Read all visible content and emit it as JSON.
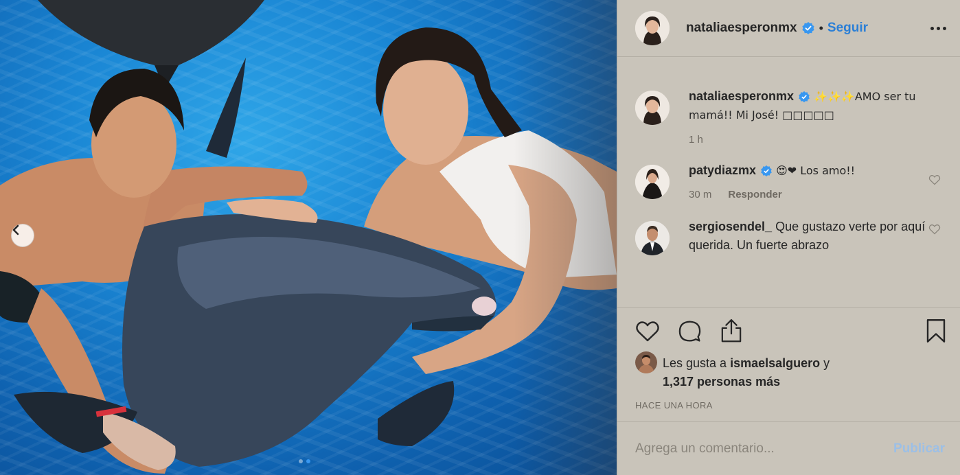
{
  "post": {
    "username": "nataliaesperonmx",
    "separator": "•",
    "follow_label": "Seguir",
    "more_icon": "more-options-icon"
  },
  "comments": [
    {
      "username": "nataliaesperonmx",
      "text": "✨✨✨AMO ser tu mamá!! Mi José! □□□□□",
      "time": "1 h",
      "avatar": "natalia-avatar"
    },
    {
      "username": "patydiazmx",
      "text": "😍❤ Los amo!!",
      "time": "30 m",
      "reply_label": "Responder",
      "avatar": "paty-avatar"
    },
    {
      "username": "sergiosendel_",
      "text": "Que gustazo verte por aquí querida. Un fuerte abrazo",
      "avatar": "sergio-avatar"
    }
  ],
  "likes": {
    "prefix": "Les gusta a ",
    "user": "ismaelsalguero",
    "conjunction": " y",
    "others": "1,317 personas más"
  },
  "time_ago": "HACE UNA HORA",
  "add_comment": {
    "placeholder": "Agrega un comentario...",
    "publish_label": "Publicar"
  },
  "colors": {
    "panel_bg": "#c9c4ba",
    "link_blue": "#2b7fd6",
    "verified_blue": "#3897f0"
  }
}
